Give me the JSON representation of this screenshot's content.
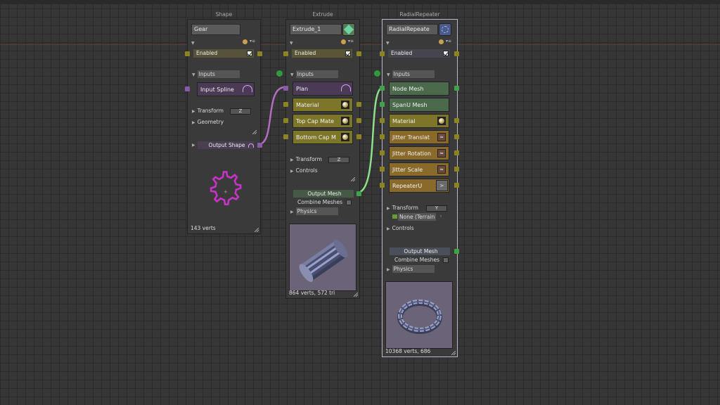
{
  "nodes": {
    "shape": {
      "title": "Shape",
      "name": "Gear",
      "enabled_label": "Enabled",
      "inputs_label": "Inputs",
      "input_spline": "Input Spline",
      "transform_label": "Transform",
      "transform_value": "Z",
      "geometry_label": "Geometry",
      "output_label": "Output Shape",
      "footer": "143 verts"
    },
    "extrude": {
      "title": "Extrude",
      "name": "Extrude_1",
      "enabled_label": "Enabled",
      "inputs_label": "Inputs",
      "plan": "Plan",
      "material": "Material",
      "top_cap": "Top Cap Mate",
      "bottom_cap": "Bottom Cap M",
      "transform_label": "Transform",
      "transform_value": "Z",
      "controls_label": "Controls",
      "output_label": "Output Mesh",
      "combine_label": "Combine Meshes",
      "physics_label": "Physics",
      "footer": "864 verts, 572 tri"
    },
    "radial": {
      "title": "RadialRepeater",
      "name": "RadialRepeate",
      "enabled_label": "Enabled",
      "inputs_label": "Inputs",
      "node_mesh": "Node Mesh",
      "spanu_mesh": "SpanU Mesh",
      "material": "Material",
      "jitter_translate": "Jitter Translat",
      "jitter_rotation": "Jitter Rotation",
      "jitter_scale": "Jitter Scale",
      "repeater_u": "RepeaterU",
      "transform_label": "Transform",
      "transform_value": "Y",
      "terrain_label": "None (Terrain",
      "controls_label": "Controls",
      "output_label": "Output Mesh",
      "combine_label": "Combine Meshes",
      "physics_label": "Physics",
      "footer": "10368 verts, 686"
    }
  },
  "colors": {
    "shape_wire": "#b46cc0",
    "mesh_wire": "#8ee08a",
    "port_olive": "#8c8420",
    "port_purple": "#8a5aa8",
    "port_green": "#3fa34a"
  }
}
